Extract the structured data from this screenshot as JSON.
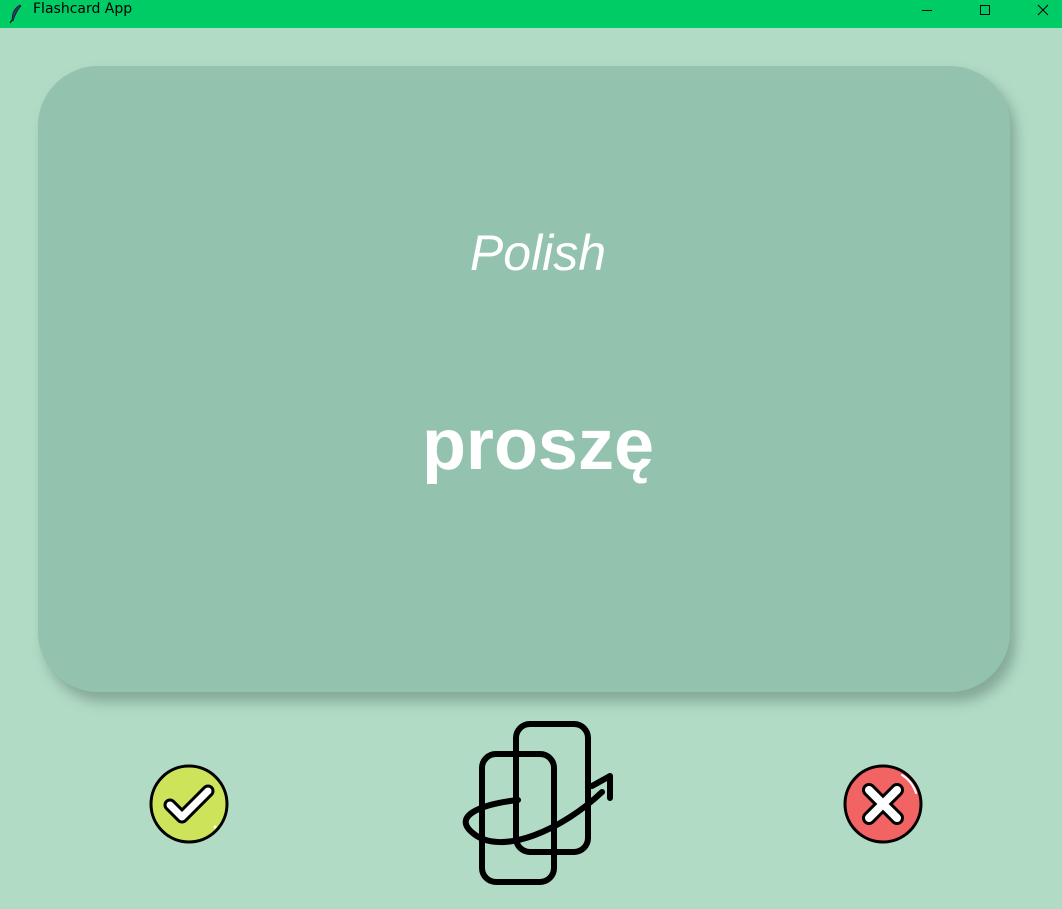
{
  "window": {
    "title": "Flashcard App",
    "controls": [
      "minimize-icon",
      "maximize-icon",
      "close-icon"
    ],
    "titlebar_color": "#00cc66"
  },
  "background_color": "#b1dbc5",
  "card": {
    "language": "Polish",
    "word": "proszę",
    "color": "#93c2af",
    "text_color": "#ffffff"
  },
  "buttons": {
    "known": {
      "icon": "checkmark-icon",
      "color": "#cde35a"
    },
    "flip": {
      "icon": "flip-card-icon"
    },
    "unknown": {
      "icon": "cross-icon",
      "color": "#f26464"
    }
  }
}
